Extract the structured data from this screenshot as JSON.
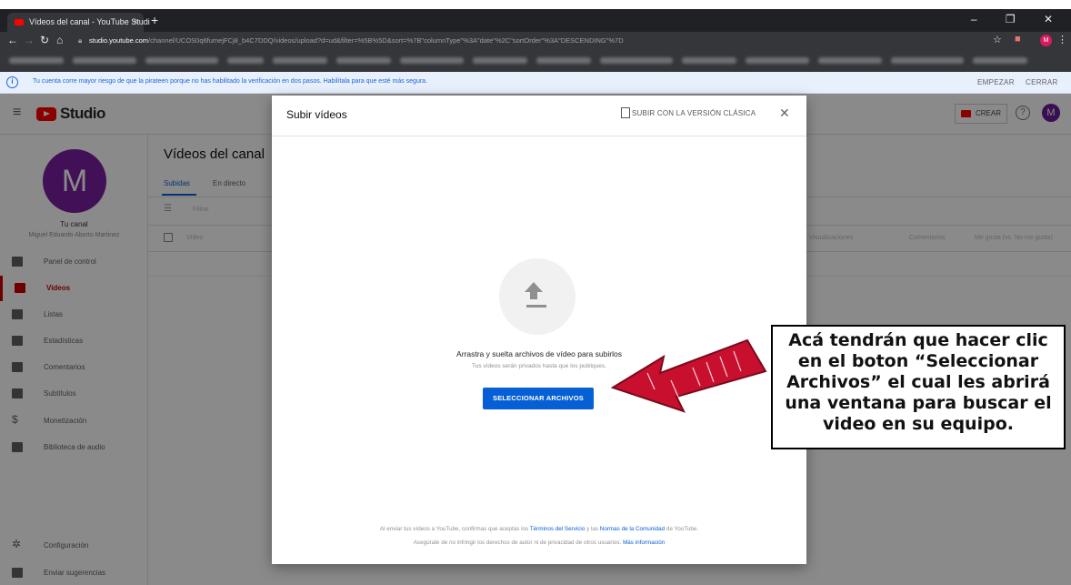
{
  "browser": {
    "tab_title": "Vídeos del canal - YouTube Studi",
    "tab_close": "×",
    "new_tab": "+",
    "window_controls": "–  ❐  ✕",
    "url_host": "studio.youtube.com",
    "url_path": "/channel/UCOS0q6fumejFCj8_b4C7DDQ/videos/upload?d=ud&filter=%5B%5D&sort=%7B\"columnType\"%3A\"date\"%2C\"sortOrder\"%3A\"DESCENDING\"%7D"
  },
  "infobar": {
    "message": "Tu cuenta corre mayor riesgo de que la pirateen porque no has habilitado la verificación en dos pasos. Habilítala para que esté más segura.",
    "start": "EMPEZAR",
    "close": "CERRAR"
  },
  "header": {
    "logo": "Studio",
    "create": "CREAR",
    "help": "?",
    "avatar": "M"
  },
  "sidebar": {
    "avatar_letter": "M",
    "channel_label": "Tu canal",
    "owner": "Miguel Eduardo Aburto Martinez",
    "items": [
      {
        "label": "Panel de control"
      },
      {
        "label": "Videos"
      },
      {
        "label": "Listas"
      },
      {
        "label": "Estadísticas"
      },
      {
        "label": "Comentarios"
      },
      {
        "label": "Subtítulos"
      },
      {
        "label": "Monetización"
      },
      {
        "label": "Biblioteca de audio"
      }
    ],
    "bottom": [
      {
        "label": "Configuración"
      },
      {
        "label": "Enviar sugerencias"
      }
    ]
  },
  "main": {
    "title": "Vídeos del canal",
    "tabs": [
      "Subidas",
      "En directo"
    ],
    "filter_placeholder": "Filtrar",
    "columns": [
      "Vídeo",
      "Visualizaciones",
      "Comentarios",
      "Me gusta (vs. No me gusta)"
    ]
  },
  "modal": {
    "title": "Subir vídeos",
    "classic": "SUBIR CON LA VERSIÓN CLÁSICA",
    "close": "✕",
    "drag_text": "Arrastra y suelta archivos de vídeo para subirlos",
    "private_note": "Tus vídeos serán privados hasta que los publiques.",
    "select_button": "SELECCIONAR ARCHIVOS",
    "legal1_a": "Al enviar tus vídeos a YouTube, confirmas que aceptas los ",
    "legal1_link1": "Términos del Servicio",
    "legal1_b": " y las ",
    "legal1_link2": "Normas de la Comunidad",
    "legal1_c": " de YouTube.",
    "legal2_a": "Asegúrate de no infringir los derechos de autor ni de privacidad de otros usuarios. ",
    "legal2_link": "Más información"
  },
  "annotation": {
    "line1": "Acá tendrán que hacer clic",
    "line2": "en el boton “Seleccionar",
    "line3": "Archivos” el cual les abrirá",
    "line4": "una ventana para buscar el",
    "line5": "video en su equipo."
  },
  "colors": {
    "accent_blue": "#065fd4",
    "youtube_red": "#ff0000",
    "annotation_red": "#c8102e"
  }
}
